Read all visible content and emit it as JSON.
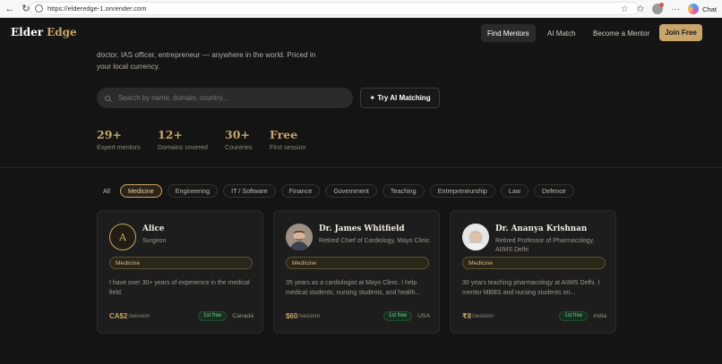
{
  "browser": {
    "url": "https://elderedge-1.onrender.com",
    "chat_label": "Chat"
  },
  "header": {
    "logo_part1": "Elder",
    "logo_part2": "Edge",
    "nav": {
      "find_mentors": "Find Mentors",
      "ai_match": "AI Match",
      "become_mentor": "Become a Mentor",
      "join_free": "Join Free"
    }
  },
  "hero": {
    "line1": "doctor, IAS officer, entrepreneur — anywhere in the world. Priced in",
    "line2": "your local currency.",
    "search_placeholder": "Search by name, domain, country...",
    "ai_button": "✦ Try AI Matching"
  },
  "stats": [
    {
      "value": "29+",
      "label": "Expert mentors"
    },
    {
      "value": "12+",
      "label": "Domains covered"
    },
    {
      "value": "30+",
      "label": "Countries"
    },
    {
      "value": "Free",
      "label": "First session"
    }
  ],
  "filters": [
    "All",
    "Medicine",
    "Engineering",
    "IT / Software",
    "Finance",
    "Government",
    "Teaching",
    "Entrepreneurship",
    "Law",
    "Defence"
  ],
  "active_filter": "Medicine",
  "mentors": [
    {
      "initial": "A",
      "name": "Alice",
      "role": "Surgeon",
      "domain": "Medicine",
      "bio": "I have over 30+ years of experience in the medical field.",
      "price": "CA$2",
      "per": "/session",
      "badge": "1st free",
      "country": "Canada"
    },
    {
      "name": "Dr. James Whitfield",
      "role": "Retired Chief of Cardiology, Mayo Clinic",
      "domain": "Medicine",
      "bio": "35 years as a cardiologist at Mayo Clinic. I help medical students, nursing students, and health...",
      "price": "$60",
      "per": "/session",
      "badge": "1st free",
      "country": "USA"
    },
    {
      "name": "Dr. Ananya Krishnan",
      "role": "Retired Professor of Pharmacology, AIIMS Delhi",
      "domain": "Medicine",
      "bio": "30 years teaching pharmacology at AIIMS Delhi. I mentor MBBS and nursing students on...",
      "price": "₹8",
      "per": "/session",
      "badge": "1st free",
      "country": "India"
    }
  ],
  "colors": {
    "accent": "#c9a56b",
    "background": "#141414",
    "card": "#1d1d1d",
    "free_badge": "#6fcf8e"
  }
}
